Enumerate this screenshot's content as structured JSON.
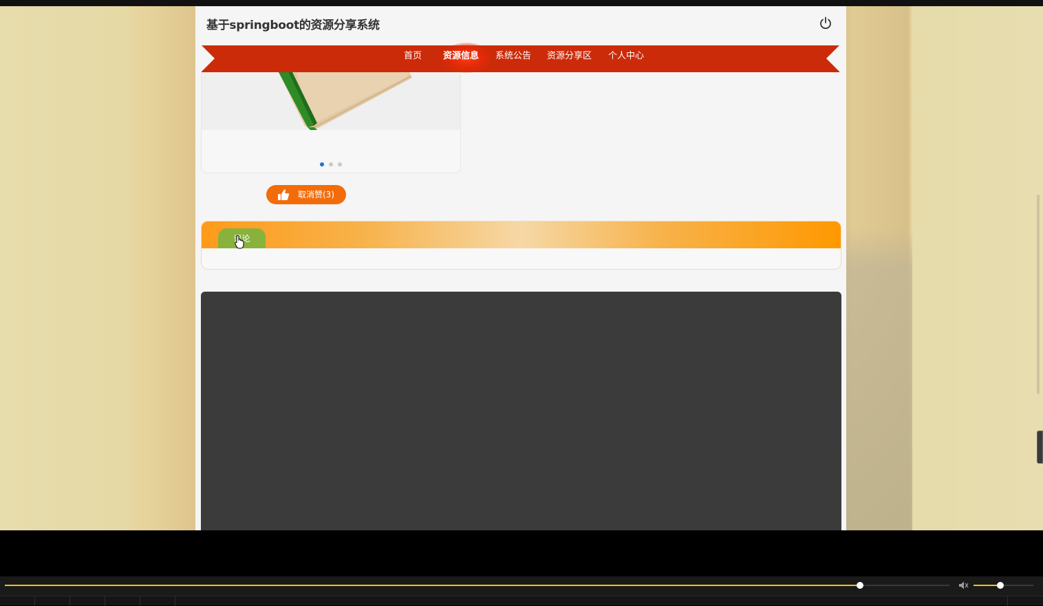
{
  "site": {
    "title": "基于springboot的资源分享系统"
  },
  "nav": {
    "items": [
      {
        "label": "首页",
        "active": false
      },
      {
        "label": "资源信息",
        "active": true
      },
      {
        "label": "系统公告",
        "active": false
      },
      {
        "label": "资源分享区",
        "active": false
      },
      {
        "label": "个人中心",
        "active": false
      }
    ]
  },
  "carousel": {
    "slide_count": 3,
    "active_index": 0
  },
  "like": {
    "label": "取消赞(3)",
    "icon": "thumbs-up-icon"
  },
  "comments": {
    "tab_label": "评论"
  },
  "header_icons": {
    "logout": "power-icon"
  },
  "player": {
    "progress": 0.905,
    "volume": 0.45,
    "volume_icon": "speaker-icon"
  },
  "colors": {
    "nav_red": "#cc2b0a",
    "like_orange": "#f36c0a",
    "comment_tab_green": "#88b23c",
    "progress_yellow": "#f0c419",
    "active_dot_blue": "#1e6fd9"
  }
}
